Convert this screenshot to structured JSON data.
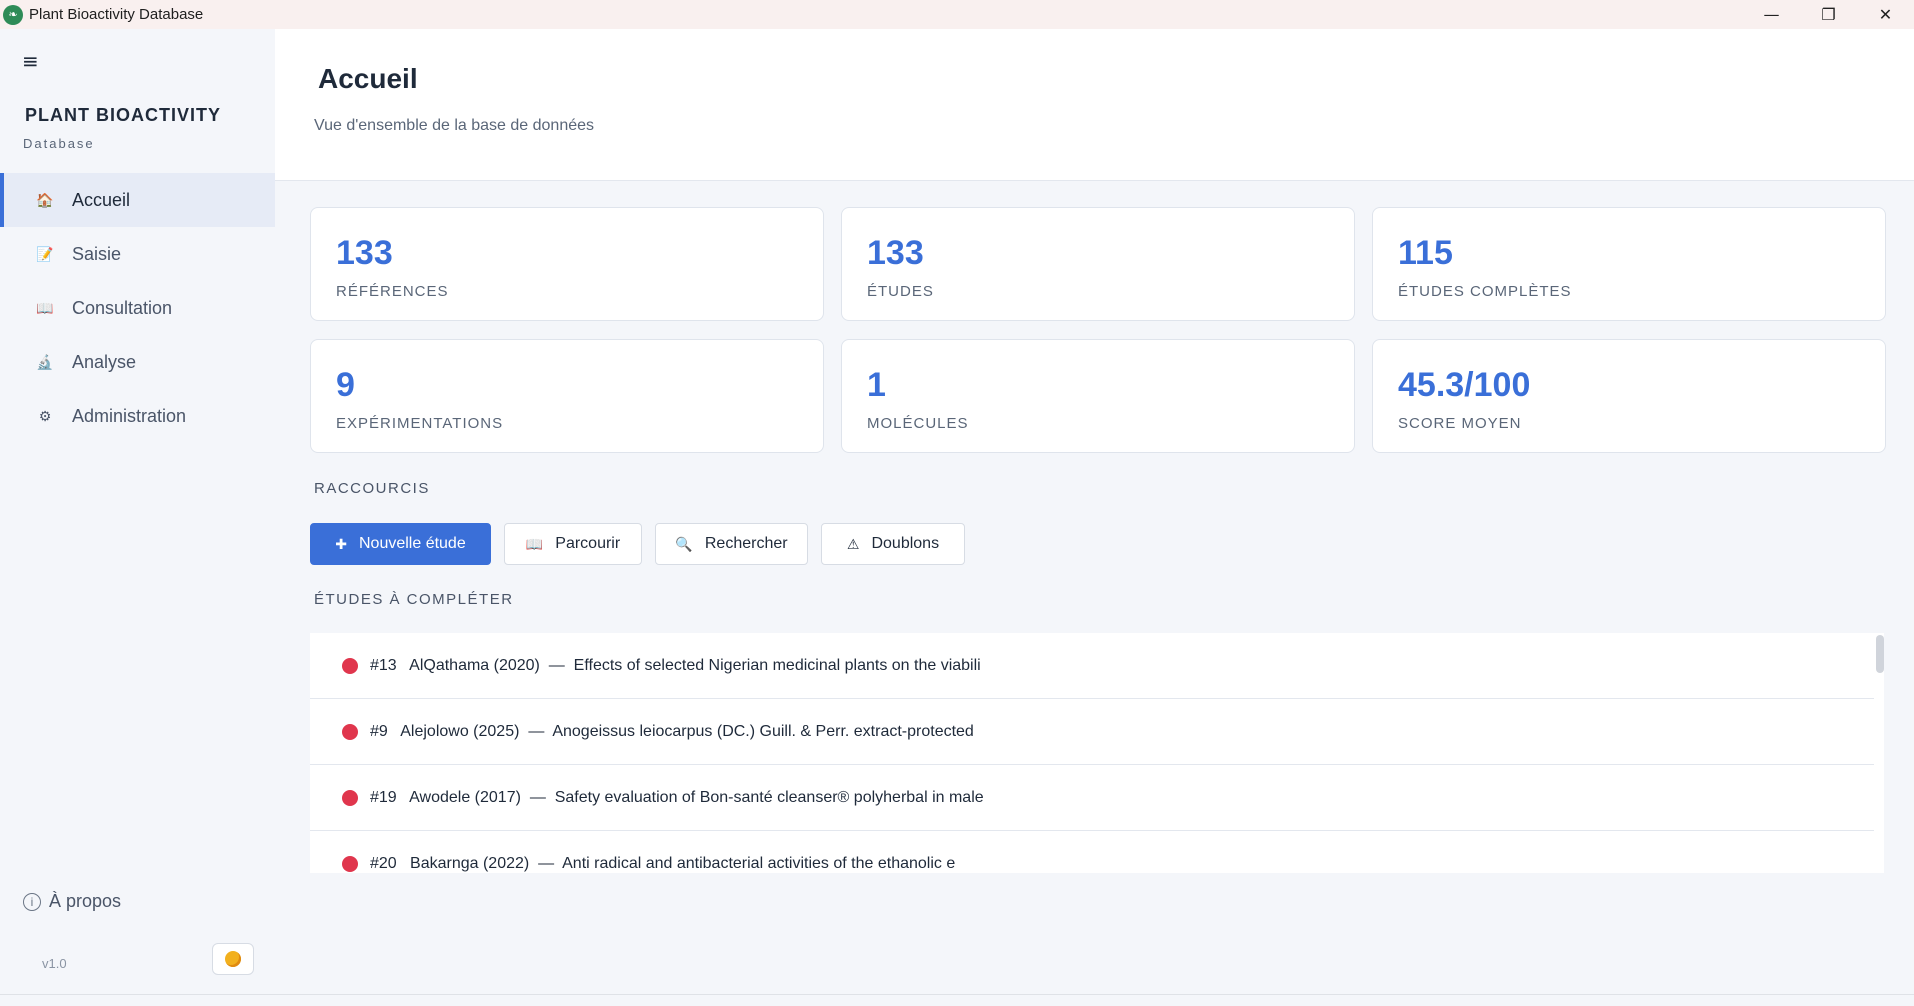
{
  "window": {
    "title": "Plant Bioactivity Database",
    "controls": [
      "minimize",
      "restore",
      "close"
    ]
  },
  "sidebar": {
    "brand_title": "PLANT BIOACTIVITY",
    "brand_sub": "Database",
    "items": [
      {
        "label": "Accueil",
        "icon": "home-icon",
        "active": true
      },
      {
        "label": "Saisie",
        "icon": "edit-icon",
        "active": false
      },
      {
        "label": "Consultation",
        "icon": "book-icon",
        "active": false
      },
      {
        "label": "Analyse",
        "icon": "microscope-icon",
        "active": false
      },
      {
        "label": "Administration",
        "icon": "gear-icon",
        "active": false
      }
    ],
    "about_label": "À propos",
    "version": "v1.0"
  },
  "header": {
    "title": "Accueil",
    "subtitle": "Vue d'ensemble de la base de données"
  },
  "stats": [
    {
      "value": "133",
      "label": "RÉFÉRENCES"
    },
    {
      "value": "133",
      "label": "ÉTUDES"
    },
    {
      "value": "115",
      "label": "ÉTUDES COMPLÈTES"
    },
    {
      "value": "9",
      "label": "EXPÉRIMENTATIONS"
    },
    {
      "value": "1",
      "label": "MOLÉCULES"
    },
    {
      "value": "45.3/100",
      "label": "SCORE MOYEN"
    }
  ],
  "shortcuts": {
    "label": "RACCOURCIS",
    "buttons": [
      {
        "label": "Nouvelle étude",
        "icon": "plus-icon"
      },
      {
        "label": "Parcourir",
        "icon": "book-icon"
      },
      {
        "label": "Rechercher",
        "icon": "search-icon"
      },
      {
        "label": "Doublons",
        "icon": "warning-icon"
      }
    ]
  },
  "to_complete": {
    "label": "ÉTUDES À COMPLÉTER",
    "items": [
      {
        "text": "#13   AlQathama (2020)  —  Effects of selected Nigerian medicinal plants on the viabili"
      },
      {
        "text": "#9   Alejolowo (2025)  —  Anogeissus leiocarpus (DC.) Guill. & Perr. extract-protected"
      },
      {
        "text": "#19   Awodele (2017)  —  Safety evaluation of Bon-santé cleanser® polyherbal in male"
      },
      {
        "text": "#20   Bakarnga (2022)  —  Anti radical and antibacterial activities of the ethanolic e"
      }
    ]
  },
  "colors": {
    "accent": "#3a6fd8",
    "status_dot": "#e0364d"
  }
}
